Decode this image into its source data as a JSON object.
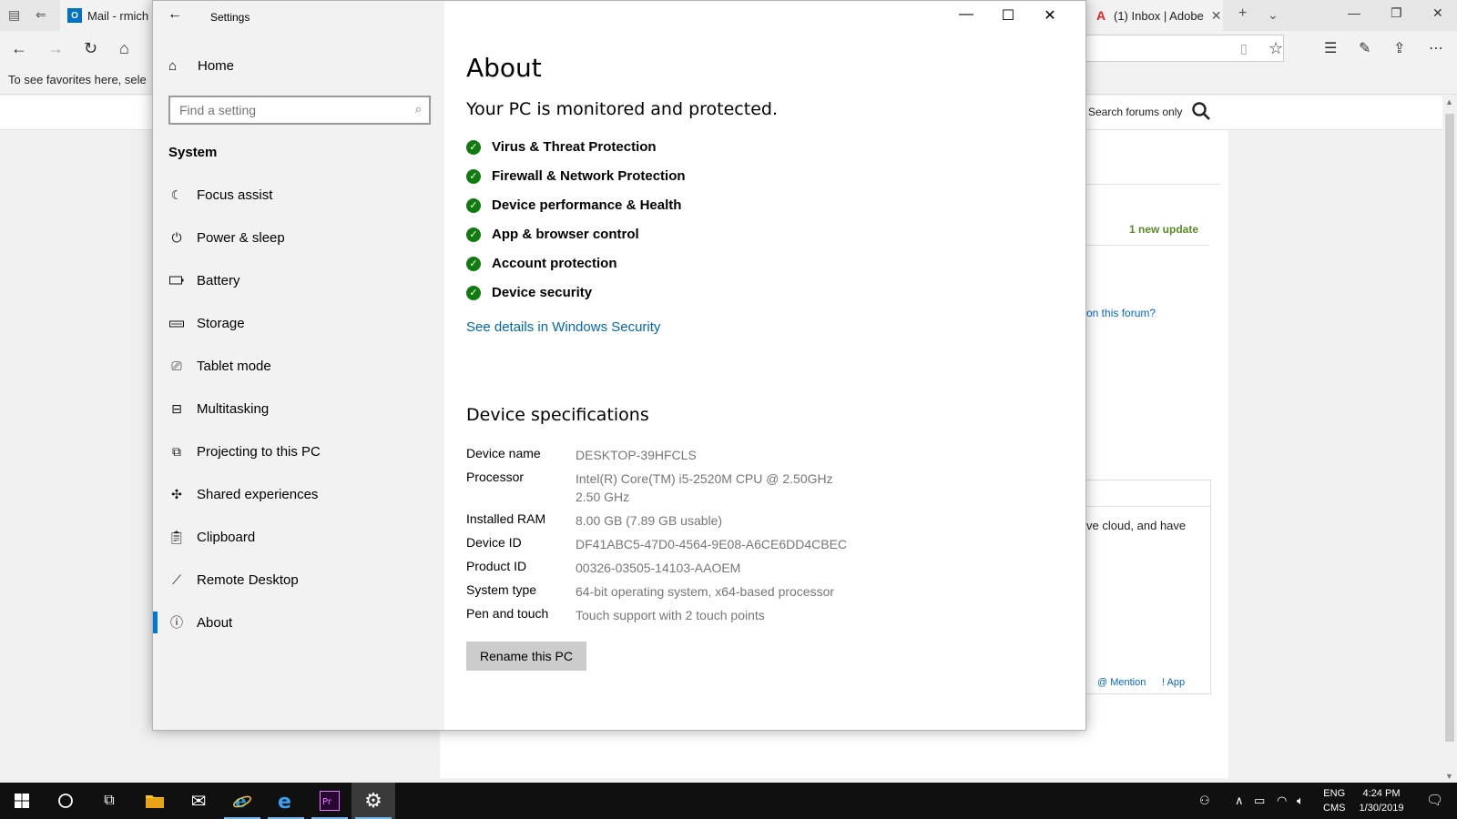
{
  "browser": {
    "tabs": [
      {
        "label": "Mail - rmich"
      },
      {
        "label": "(1) Inbox | Adobe"
      }
    ],
    "favorites_hint": "To see favorites here, sele",
    "search_forums": "Search forums only",
    "new_update": "1 new update",
    "forum_link": "on this forum?",
    "reply_text": "ve cloud, and have",
    "mention": "@ Mention",
    "app": "! App"
  },
  "settings": {
    "window_title": "Settings",
    "home_label": "Home",
    "search_placeholder": "Find a setting",
    "section_title": "System",
    "nav": [
      {
        "label": "Focus assist",
        "icon": "moon-icon"
      },
      {
        "label": "Power & sleep",
        "icon": "power-icon"
      },
      {
        "label": "Battery",
        "icon": "battery-icon"
      },
      {
        "label": "Storage",
        "icon": "storage-icon"
      },
      {
        "label": "Tablet mode",
        "icon": "tablet-icon"
      },
      {
        "label": "Multitasking",
        "icon": "multitasking-icon"
      },
      {
        "label": "Projecting to this PC",
        "icon": "projecting-icon"
      },
      {
        "label": "Shared experiences",
        "icon": "shared-icon"
      },
      {
        "label": "Clipboard",
        "icon": "clipboard-icon"
      },
      {
        "label": "Remote Desktop",
        "icon": "remote-icon"
      },
      {
        "label": "About",
        "icon": "info-icon",
        "selected": true
      }
    ],
    "about": {
      "title": "About",
      "protect_heading": "Your PC is monitored and protected.",
      "protections": [
        "Virus & Threat Protection",
        "Firewall & Network Protection",
        "Device performance & Health",
        "App & browser control",
        "Account protection",
        "Device security"
      ],
      "security_link": "See details in Windows Security",
      "spec_heading": "Device specifications",
      "specs": [
        {
          "label": "Device name",
          "value": "DESKTOP-39HFCLS"
        },
        {
          "label": "Processor",
          "value": "Intel(R) Core(TM) i5-2520M CPU @ 2.50GHz 2.50 GHz"
        },
        {
          "label": "Installed RAM",
          "value": "8.00 GB (7.89 GB usable)"
        },
        {
          "label": "Device ID",
          "value": "DF41ABC5-47D0-4564-9E08-A6CE6DD4CBEC"
        },
        {
          "label": "Product ID",
          "value": "00326-03505-14103-AAOEM"
        },
        {
          "label": "System type",
          "value": "64-bit operating system, x64-based processor"
        },
        {
          "label": "Pen and touch",
          "value": "Touch support with 2 touch points"
        }
      ],
      "rename_button": "Rename this PC"
    }
  },
  "taskbar": {
    "lang_line1": "ENG",
    "lang_line2": "CMS",
    "time": "4:24 PM",
    "date": "1/30/2019"
  },
  "colors": {
    "accent": "#0078d7",
    "link": "#0067b8",
    "check": "#107c10"
  }
}
